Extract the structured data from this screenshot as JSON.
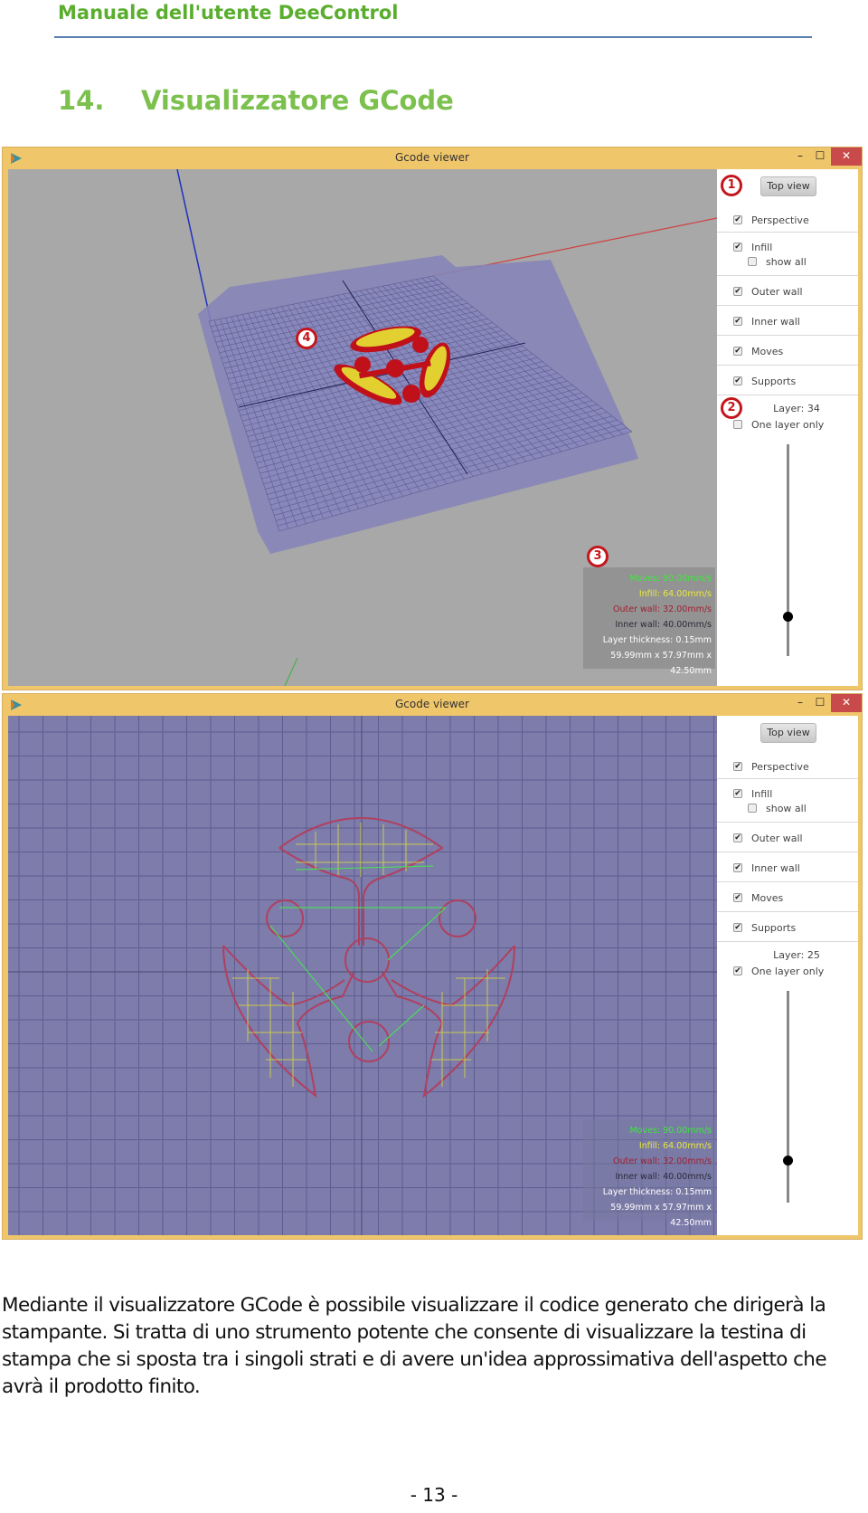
{
  "header": {
    "running_title": "Manuale dell'utente DeeControl",
    "section_number": "14.",
    "section_title": "Visualizzatore GCode"
  },
  "windows": [
    {
      "title": "Gcode viewer",
      "view": "perspective-3d",
      "controls": {
        "minimize_icon": "minimize-icon",
        "maximize_icon": "maximize-icon",
        "close_icon": "close-icon",
        "min_glyph": "–",
        "max_glyph": "☐",
        "close_glyph": "✕"
      },
      "panel": {
        "top_view_label": "Top view",
        "options": [
          {
            "label": "Perspective",
            "checked": true
          },
          {
            "label": "Infill",
            "checked": true
          },
          {
            "label": "show all",
            "checked": false
          },
          {
            "label": "Outer wall",
            "checked": true
          },
          {
            "label": "Inner wall",
            "checked": true
          },
          {
            "label": "Moves",
            "checked": true
          },
          {
            "label": "Supports",
            "checked": true
          }
        ],
        "layer_label": "Layer: 34",
        "one_layer_only": {
          "label": "One layer only",
          "checked": false
        },
        "slider_value_fraction": 0.81
      },
      "info": {
        "moves": "Moves: 90.00mm/s",
        "infill": "Infill: 64.00mm/s",
        "outer_wall": "Outer wall: 32.00mm/s",
        "inner_wall": "Inner wall: 40.00mm/s",
        "layer_thickness": "Layer thickness: 0.15mm",
        "dimensions": "59.99mm x 57.97mm x 42.50mm"
      },
      "callouts": [
        "1",
        "2",
        "3",
        "4"
      ]
    },
    {
      "title": "Gcode viewer",
      "view": "top-view",
      "controls": {
        "min_glyph": "–",
        "max_glyph": "☐",
        "close_glyph": "✕"
      },
      "panel": {
        "top_view_label": "Top view",
        "options": [
          {
            "label": "Perspective",
            "checked": true
          },
          {
            "label": "Infill",
            "checked": true
          },
          {
            "label": "show all",
            "checked": false
          },
          {
            "label": "Outer wall",
            "checked": true
          },
          {
            "label": "Inner wall",
            "checked": true
          },
          {
            "label": "Moves",
            "checked": true
          },
          {
            "label": "Supports",
            "checked": true
          }
        ],
        "layer_label": "Layer: 25",
        "one_layer_only": {
          "label": "One layer only",
          "checked": true
        },
        "slider_value_fraction": 0.8
      },
      "info": {
        "moves": "Moves: 90.00mm/s",
        "infill": "Infill: 64.00mm/s",
        "outer_wall": "Outer wall: 32.00mm/s",
        "inner_wall": "Inner wall: 40.00mm/s",
        "layer_thickness": "Layer thickness: 0.15mm",
        "dimensions": "59.99mm x 57.97mm x 42.50mm"
      }
    }
  ],
  "colors": {
    "heading_green": "#5aae2e",
    "title_green": "#7cc04e",
    "window_frame": "#f0c66a",
    "close_red": "#c94a4a",
    "callout_red": "#c4161c",
    "viewport_gray": "#a8a8a8",
    "bed_purple": "#7d7cab",
    "moves": "#3ee83e",
    "infill": "#e8e840",
    "outer_wall": "#a02030"
  },
  "body_text": "Mediante il visualizzatore GCode è possibile visualizzare il codice generato che dirigerà la stampante. Si tratta di uno strumento potente che consente di visualizzare la testina di stampa che si sposta tra i singoli strati e di avere un'idea approssimativa dell'aspetto che avrà il prodotto finito.",
  "page_number": "- 13 -"
}
